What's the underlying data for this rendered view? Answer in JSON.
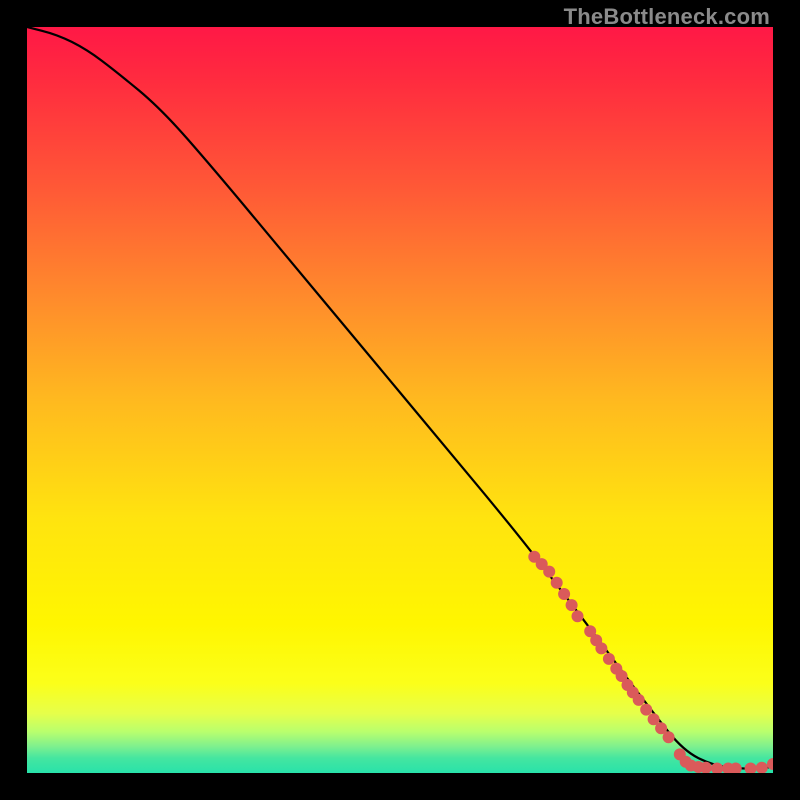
{
  "watermark": "TheBottleneck.com",
  "chart_data": {
    "type": "line",
    "title": "",
    "xlabel": "",
    "ylabel": "",
    "xlim": [
      0,
      100
    ],
    "ylim": [
      0,
      100
    ],
    "grid": false,
    "curve": {
      "name": "fit",
      "color": "#000000",
      "x": [
        0,
        4,
        8,
        12,
        18,
        25,
        35,
        45,
        55,
        65,
        72,
        78,
        84,
        88,
        92,
        96,
        100
      ],
      "y": [
        100,
        99,
        97,
        94,
        89,
        81,
        69,
        57,
        45,
        33,
        24,
        16,
        8,
        3,
        1,
        0.5,
        0.8
      ]
    },
    "highlight_points": {
      "name": "cluster",
      "color": "#da5a5a",
      "radius": 6,
      "points": [
        {
          "x": 68,
          "y": 29
        },
        {
          "x": 69,
          "y": 28
        },
        {
          "x": 70,
          "y": 27
        },
        {
          "x": 71,
          "y": 25.5
        },
        {
          "x": 72,
          "y": 24
        },
        {
          "x": 73,
          "y": 22.5
        },
        {
          "x": 73.8,
          "y": 21
        },
        {
          "x": 75.5,
          "y": 19
        },
        {
          "x": 76.3,
          "y": 17.8
        },
        {
          "x": 77,
          "y": 16.7
        },
        {
          "x": 78,
          "y": 15.3
        },
        {
          "x": 79,
          "y": 14
        },
        {
          "x": 79.7,
          "y": 13
        },
        {
          "x": 80.5,
          "y": 11.8
        },
        {
          "x": 81.2,
          "y": 10.8
        },
        {
          "x": 82,
          "y": 9.8
        },
        {
          "x": 83,
          "y": 8.5
        },
        {
          "x": 84,
          "y": 7.2
        },
        {
          "x": 85,
          "y": 6
        },
        {
          "x": 86,
          "y": 4.8
        },
        {
          "x": 87.5,
          "y": 2.5
        },
        {
          "x": 88.3,
          "y": 1.5
        },
        {
          "x": 89,
          "y": 1
        },
        {
          "x": 90,
          "y": 0.8
        },
        {
          "x": 91,
          "y": 0.7
        },
        {
          "x": 92.5,
          "y": 0.6
        },
        {
          "x": 94,
          "y": 0.6
        },
        {
          "x": 95,
          "y": 0.6
        },
        {
          "x": 97,
          "y": 0.6
        },
        {
          "x": 98.5,
          "y": 0.7
        },
        {
          "x": 100,
          "y": 1.2
        }
      ]
    }
  }
}
